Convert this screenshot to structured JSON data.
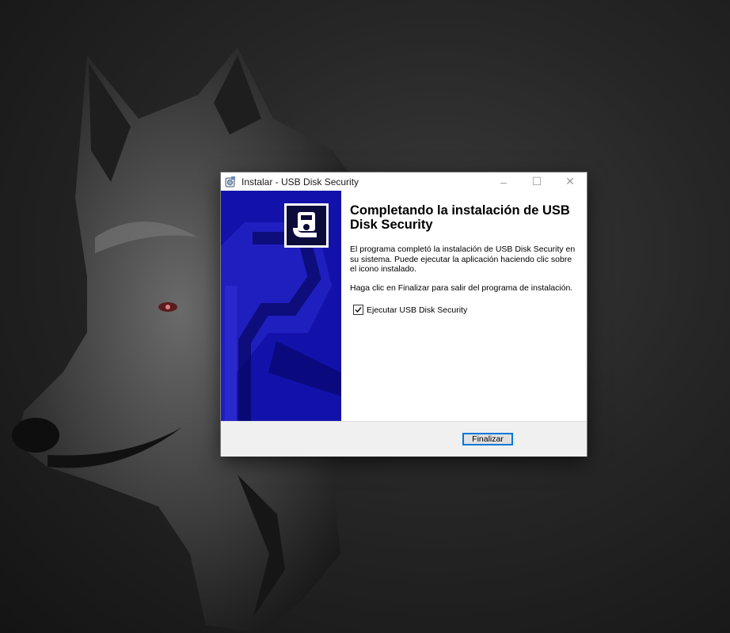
{
  "window": {
    "title": "Instalar - USB Disk Security",
    "caption_buttons": {
      "minimize": "–",
      "maximize": "☐",
      "close": "✕"
    }
  },
  "wizard": {
    "heading": "Completando la instalación de USB Disk Security",
    "paragraph_1": "El programa completó la instalación de USB Disk Security en su sistema. Puede ejecutar la aplicación haciendo clic sobre el icono instalado.",
    "paragraph_2": "Haga clic en Finalizar para salir del programa de instalación.",
    "run_checkbox": {
      "label": "Ejecutar USB Disk Security",
      "checked": true
    },
    "finish_button": "Finalizar"
  },
  "colors": {
    "banner_blue": "#1010a8",
    "button_border": "#0078d7"
  },
  "icons": {
    "app": "usb-disk-security-app-icon",
    "banner_logo": "usb-disk-security-logo"
  }
}
